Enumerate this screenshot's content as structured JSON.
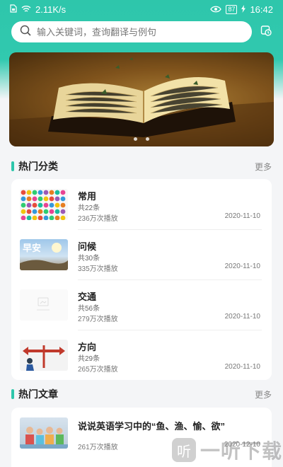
{
  "status_bar": {
    "network_speed": "2.11K/s",
    "battery": "87",
    "time": "16:42"
  },
  "search": {
    "placeholder": "输入关键词，查询翻译与例句"
  },
  "sections": {
    "categories": {
      "title": "热门分类",
      "more": "更多"
    },
    "articles": {
      "title": "热门文章",
      "more": "更多"
    }
  },
  "categories": [
    {
      "title": "常用",
      "count": "共22条",
      "plays": "236万次播放",
      "date": "2020-11-10"
    },
    {
      "title": "问候",
      "count": "共30条",
      "plays": "335万次播放",
      "date": "2020-11-10",
      "thumb_text": "早安"
    },
    {
      "title": "交通",
      "count": "共56条",
      "plays": "279万次播放",
      "date": "2020-11-10"
    },
    {
      "title": "方向",
      "count": "共29条",
      "plays": "265万次播放",
      "date": "2020-11-10"
    }
  ],
  "articles": [
    {
      "title": "说说英语学习中的“鱼、渔、愉、欲”",
      "plays": "261万次播放",
      "date": "2020-12-10"
    }
  ],
  "watermark": {
    "logo": "听",
    "text": "一听下载"
  },
  "colors": {
    "accent": "#2ec6ab"
  }
}
